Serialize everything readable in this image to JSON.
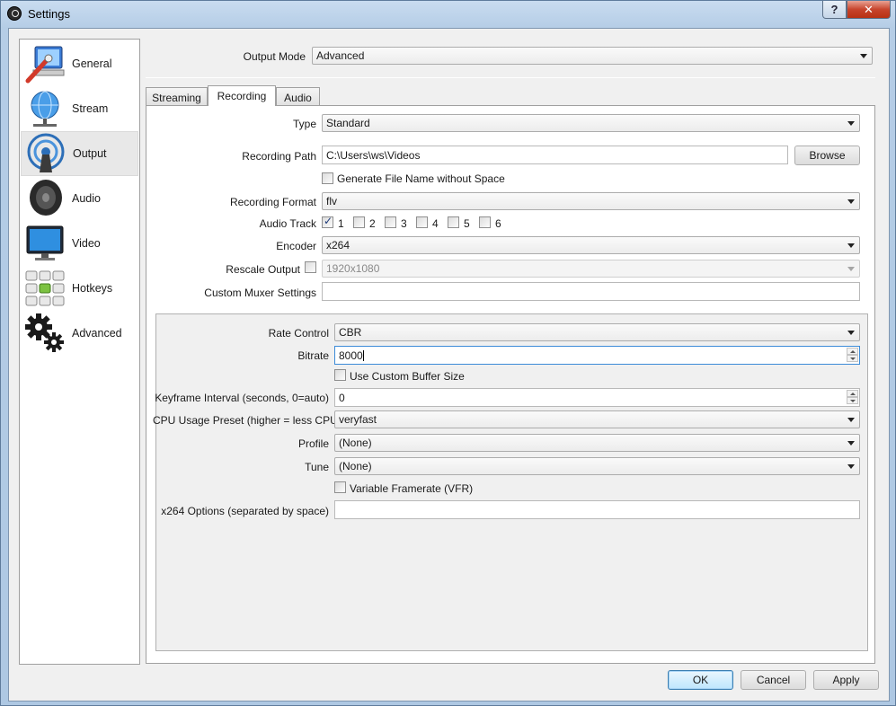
{
  "window": {
    "title": "Settings",
    "help_label": "?",
    "close_label": "✕"
  },
  "sidebar": {
    "items": [
      {
        "label": "General",
        "icon": "general-icon"
      },
      {
        "label": "Stream",
        "icon": "stream-icon"
      },
      {
        "label": "Output",
        "icon": "output-icon",
        "active": true
      },
      {
        "label": "Audio",
        "icon": "audio-icon"
      },
      {
        "label": "Video",
        "icon": "video-icon"
      },
      {
        "label": "Hotkeys",
        "icon": "hotkeys-icon"
      },
      {
        "label": "Advanced",
        "icon": "advanced-icon"
      }
    ]
  },
  "output_mode": {
    "label": "Output Mode",
    "value": "Advanced"
  },
  "tabs": [
    {
      "label": "Streaming"
    },
    {
      "label": "Recording",
      "active": true
    },
    {
      "label": "Audio"
    }
  ],
  "recording": {
    "type": {
      "label": "Type",
      "value": "Standard"
    },
    "path": {
      "label": "Recording Path",
      "value": "C:\\Users\\ws\\Videos",
      "browse_label": "Browse"
    },
    "no_space": {
      "label": "Generate File Name without Space",
      "checked": false
    },
    "format": {
      "label": "Recording Format",
      "value": "flv"
    },
    "audio_track": {
      "label": "Audio Track",
      "tracks": [
        {
          "label": "1",
          "checked": true
        },
        {
          "label": "2",
          "checked": false
        },
        {
          "label": "3",
          "checked": false
        },
        {
          "label": "4",
          "checked": false
        },
        {
          "label": "5",
          "checked": false
        },
        {
          "label": "6",
          "checked": false
        }
      ]
    },
    "encoder": {
      "label": "Encoder",
      "value": "x264"
    },
    "rescale": {
      "label": "Rescale Output",
      "checked": false,
      "value": "1920x1080"
    },
    "muxer": {
      "label": "Custom Muxer Settings",
      "value": ""
    }
  },
  "encoder_settings": {
    "rate_control": {
      "label": "Rate Control",
      "value": "CBR"
    },
    "bitrate": {
      "label": "Bitrate",
      "value": "8000"
    },
    "custom_buffer": {
      "label": "Use Custom Buffer Size",
      "checked": false
    },
    "keyframe": {
      "label": "Keyframe Interval (seconds, 0=auto)",
      "value": "0"
    },
    "cpu_preset": {
      "label": "CPU Usage Preset (higher = less CPU)",
      "value": "veryfast"
    },
    "profile": {
      "label": "Profile",
      "value": "(None)"
    },
    "tune": {
      "label": "Tune",
      "value": "(None)"
    },
    "vfr": {
      "label": "Variable Framerate (VFR)",
      "checked": false
    },
    "x264_options": {
      "label": "x264 Options (separated by space)",
      "value": ""
    }
  },
  "footer": {
    "ok_label": "OK",
    "cancel_label": "Cancel",
    "apply_label": "Apply"
  }
}
